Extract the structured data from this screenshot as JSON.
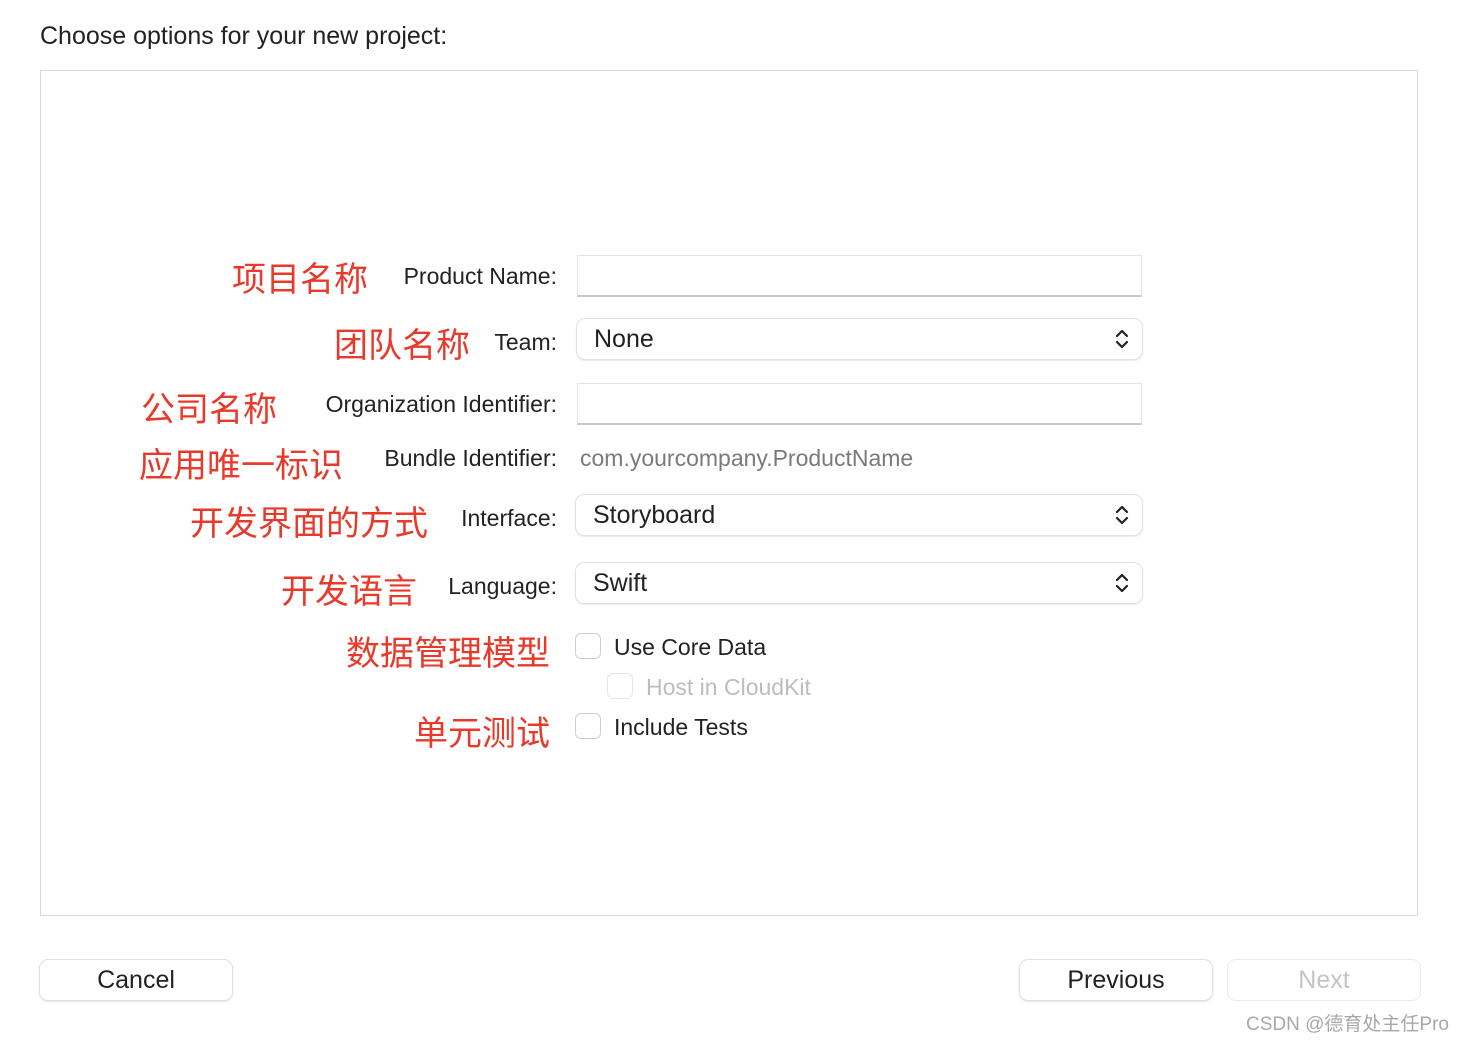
{
  "dialog": {
    "title": "Choose options for your new project:"
  },
  "form": {
    "product_name": {
      "label": "Product Name:",
      "value": "",
      "annotation": "项目名称"
    },
    "team": {
      "label": "Team:",
      "value": "None",
      "annotation": "团队名称"
    },
    "org_id": {
      "label": "Organization Identifier:",
      "value": "",
      "annotation": "公司名称"
    },
    "bundle_id": {
      "label": "Bundle Identifier:",
      "value": "com.yourcompany.ProductName",
      "annotation": "应用唯一标识"
    },
    "interface": {
      "label": "Interface:",
      "value": "Storyboard",
      "annotation": "开发界面的方式"
    },
    "language": {
      "label": "Language:",
      "value": "Swift",
      "annotation": "开发语言"
    },
    "core_data": {
      "label": "Use Core Data",
      "checked": false,
      "annotation": "数据管理模型"
    },
    "cloudkit": {
      "label": "Host in CloudKit",
      "checked": false,
      "disabled": true
    },
    "tests": {
      "label": "Include Tests",
      "checked": false,
      "annotation": "单元测试"
    }
  },
  "buttons": {
    "cancel": "Cancel",
    "previous": "Previous",
    "next": "Next"
  },
  "watermark": "CSDN @德育处主任Pro",
  "colors": {
    "annotation": "#e8392a",
    "disabled_text": "#bdbdbd"
  }
}
